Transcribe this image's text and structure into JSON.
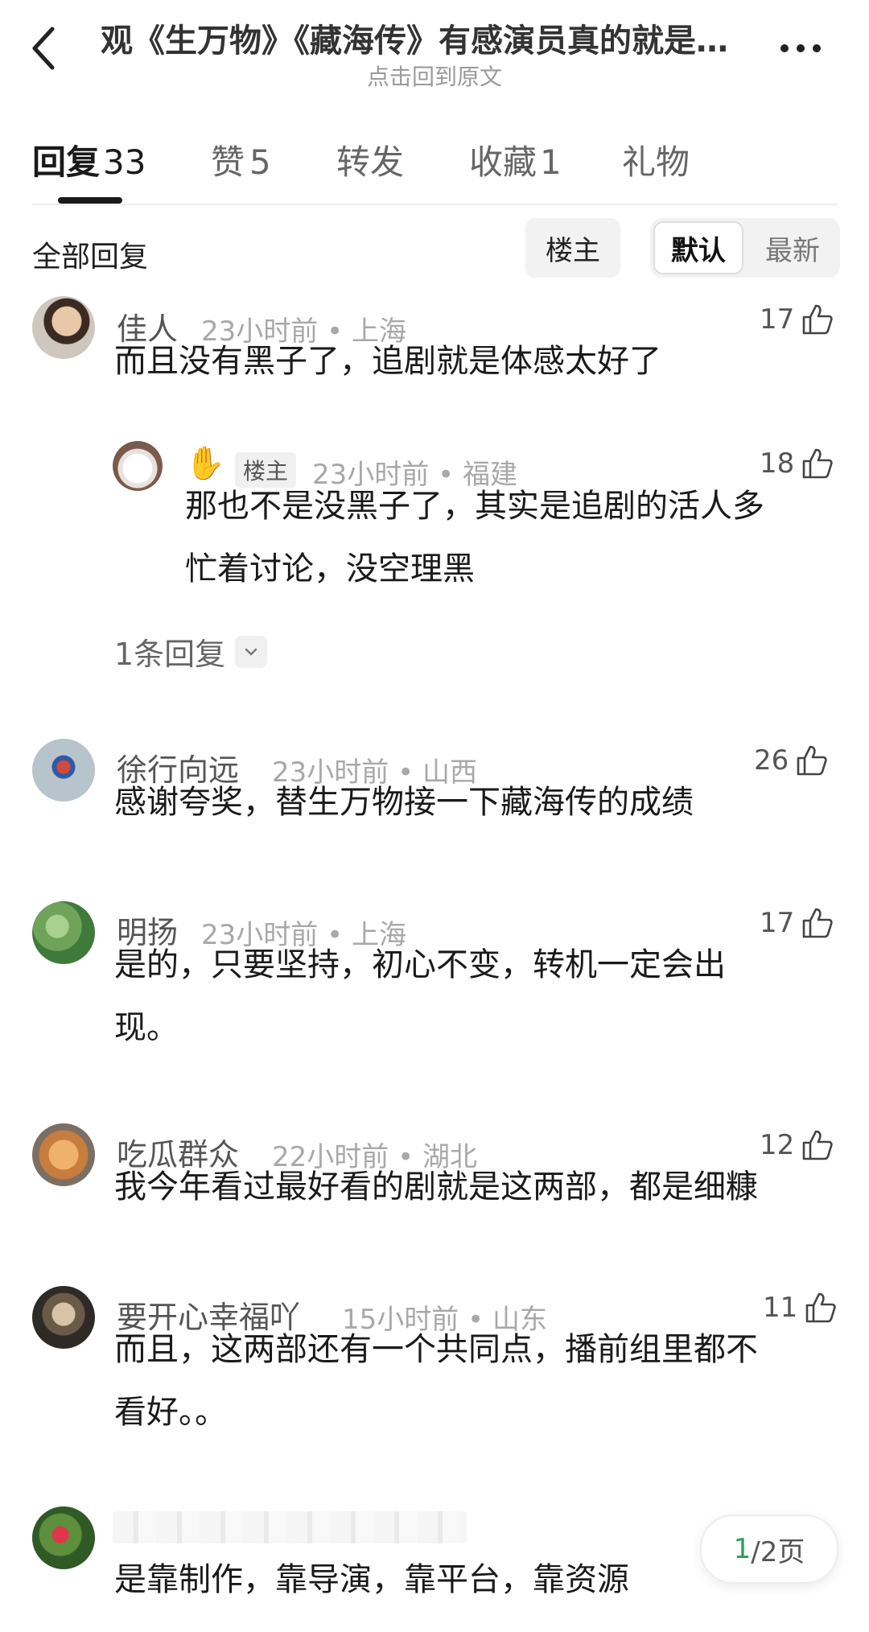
{
  "header": {
    "title": "观《生万物》《藏海传》有感演员真的就是…",
    "subtitle": "点击回到原文"
  },
  "tabs": [
    {
      "label": "回复",
      "count": "33"
    },
    {
      "label": "赞",
      "count": "5"
    },
    {
      "label": "转发",
      "count": ""
    },
    {
      "label": "收藏",
      "count": "1"
    },
    {
      "label": "礼物",
      "count": ""
    }
  ],
  "filter": {
    "all_label": "全部回复",
    "owner_label": "楼主",
    "sort_default": "默认",
    "sort_latest": "最新"
  },
  "comments": [
    {
      "name": "佳人",
      "time": "23小时前",
      "loc": "上海",
      "likes": "17",
      "text": [
        "而且没有黑子了，追剧就是体感太好了"
      ]
    },
    {
      "name": "",
      "badge": "✋",
      "tag": "楼主",
      "time": "23小时前",
      "loc": "福建",
      "likes": "18",
      "text": [
        "那也不是没黑子了，其实是追剧的活人多",
        "忙着讨论，没空理黑"
      ]
    },
    {
      "name": "徐行向远",
      "time": "23小时前",
      "loc": "山西",
      "likes": "26",
      "text": [
        "感谢夸奖，替生万物接一下藏海传的成绩"
      ]
    },
    {
      "name": "明扬",
      "time": "23小时前",
      "loc": "上海",
      "likes": "17",
      "text": [
        "是的，只要坚持，初心不变，转机一定会出",
        "现。"
      ]
    },
    {
      "name": "吃瓜群众",
      "time": "22小时前",
      "loc": "湖北",
      "likes": "12",
      "text": [
        "我今年看过最好看的剧就是这两部，都是细糠"
      ]
    },
    {
      "name": "要开心幸福吖",
      "time": "15小时前",
      "loc": "山东",
      "likes": "11",
      "text": [
        "而且，这两部还有一个共同点，播前组里都不",
        "看好。。"
      ]
    },
    {
      "name": "",
      "time": "",
      "loc": "",
      "likes": "",
      "text": [
        "是靠制作，靠导演，靠平台，靠资源"
      ]
    }
  ],
  "sub_replies": {
    "label": "1条回复"
  },
  "separator": "•",
  "pager": {
    "current": "1",
    "rest": "/2页"
  },
  "colors": {
    "pager_current": "#2aa055",
    "badge": "#f5b400"
  }
}
